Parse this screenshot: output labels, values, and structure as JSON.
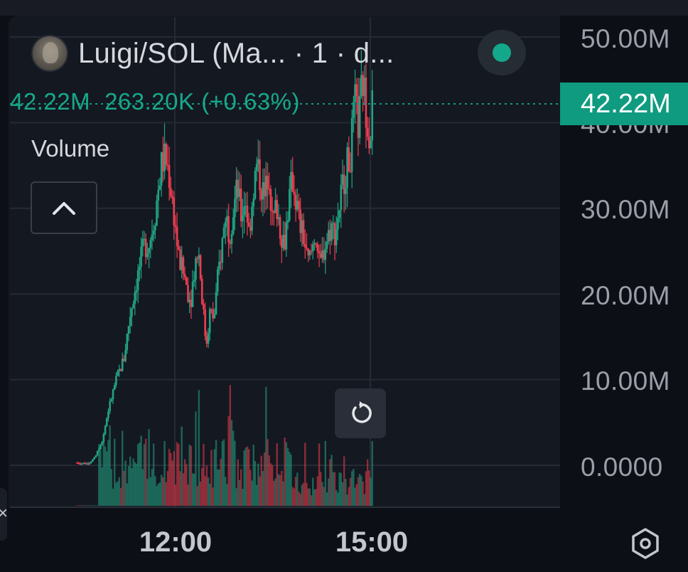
{
  "header": {
    "pair_title": "Luigi/SOL (Ma...  · 1 · d...",
    "ohlc_text": "42.22M",
    "change_text": "263.20K (+0.63%)",
    "volume_label": "Volume"
  },
  "price_badge": "42.22M",
  "colors": {
    "up": "#22a384",
    "down": "#ec3e4f",
    "accent": "#0f9b80",
    "live": "#14a88a"
  },
  "icons": {
    "collapse": "chevron-up-icon",
    "reset": "reset-icon",
    "settings": "settings-icon",
    "close": "close-icon"
  },
  "left_tab_glyph": "×",
  "chart_data": {
    "type": "candlestick",
    "title": "Luigi/SOL (Ma...  · 1 · d...",
    "y_ticks": [
      "50.00M",
      "40.00M",
      "30.00M",
      "20.00M",
      "10.00M",
      "0.0000"
    ],
    "x_ticks": [
      "12:00",
      "15:00"
    ],
    "ylim": [
      0,
      50000000
    ],
    "last_price": 42220000,
    "series": [
      {
        "name": "price",
        "close_path": [
          [
            0,
            0.3
          ],
          [
            0.05,
            0.2
          ],
          [
            0.09,
            0.8
          ],
          [
            0.13,
            3.0
          ],
          [
            0.16,
            6.5
          ],
          [
            0.2,
            10.0
          ],
          [
            0.24,
            12.5
          ],
          [
            0.27,
            17.5
          ],
          [
            0.3,
            21.0
          ],
          [
            0.34,
            25.5
          ],
          [
            0.37,
            26.0
          ],
          [
            0.4,
            29.5
          ],
          [
            0.43,
            35.0
          ],
          [
            0.45,
            36.0
          ],
          [
            0.47,
            34.0
          ],
          [
            0.5,
            28.5
          ],
          [
            0.52,
            24.0
          ],
          [
            0.55,
            22.0
          ],
          [
            0.58,
            19.0
          ],
          [
            0.6,
            23.0
          ],
          [
            0.62,
            25.5
          ],
          [
            0.64,
            19.5
          ],
          [
            0.66,
            14.0
          ],
          [
            0.68,
            18.0
          ],
          [
            0.7,
            17.0
          ],
          [
            0.72,
            22.0
          ],
          [
            0.74,
            25.5
          ],
          [
            0.76,
            29.5
          ],
          [
            0.78,
            27.0
          ],
          [
            0.8,
            30.0
          ],
          [
            0.82,
            32.5
          ],
          [
            0.84,
            29.0
          ],
          [
            0.86,
            31.5
          ],
          [
            0.88,
            27.0
          ],
          [
            0.9,
            32.0
          ],
          [
            0.92,
            35.0
          ],
          [
            0.94,
            33.0
          ],
          [
            0.96,
            31.0
          ],
          [
            0.98,
            35.0
          ],
          [
            1.0,
            28.0
          ],
          [
            1.02,
            30.5
          ],
          [
            1.04,
            27.5
          ],
          [
            1.06,
            26.0
          ],
          [
            1.08,
            30.0
          ],
          [
            1.1,
            33.5
          ],
          [
            1.12,
            31.0
          ],
          [
            1.14,
            28.0
          ],
          [
            1.16,
            26.5
          ],
          [
            1.18,
            23.5
          ],
          [
            1.2,
            25.0
          ],
          [
            1.22,
            27.5
          ],
          [
            1.24,
            23.0
          ],
          [
            1.26,
            25.0
          ],
          [
            1.28,
            26.5
          ],
          [
            1.3,
            28.0
          ],
          [
            1.32,
            27.0
          ],
          [
            1.34,
            30.0
          ],
          [
            1.36,
            33.0
          ],
          [
            1.38,
            35.0
          ],
          [
            1.4,
            36.5
          ],
          [
            1.42,
            42.5
          ],
          [
            1.44,
            39.5
          ],
          [
            1.46,
            45.0
          ],
          [
            1.48,
            41.5
          ],
          [
            1.5,
            38.0
          ],
          [
            1.51,
            42.22
          ]
        ]
      }
    ]
  }
}
